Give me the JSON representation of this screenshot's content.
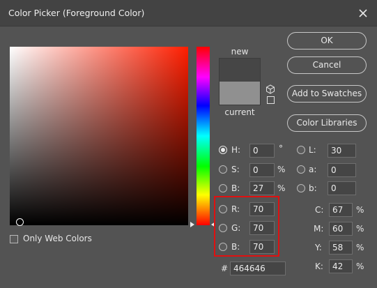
{
  "window": {
    "title": "Color Picker (Foreground Color)",
    "close_icon": "close-icon"
  },
  "preview": {
    "new_label": "new",
    "current_label": "current",
    "new_color": "#464646",
    "current_color": "#909090"
  },
  "buttons": {
    "ok": "OK",
    "cancel": "Cancel",
    "add_to_swatches": "Add to Swatches",
    "color_libraries": "Color Libraries"
  },
  "hsb": {
    "h_label": "H:",
    "h_value": "0",
    "h_unit": "°",
    "s_label": "S:",
    "s_value": "0",
    "s_unit": "%",
    "b_label": "B:",
    "b_value": "27",
    "b_unit": "%"
  },
  "lab": {
    "l_label": "L:",
    "l_value": "30",
    "a_label": "a:",
    "a_value": "0",
    "b_label": "b:",
    "b_value": "0"
  },
  "rgb": {
    "r_label": "R:",
    "r_value": "70",
    "g_label": "G:",
    "g_value": "70",
    "b_label": "B:",
    "b_value": "70"
  },
  "cmyk": {
    "c_label": "C:",
    "c_value": "67",
    "c_unit": "%",
    "m_label": "M:",
    "m_value": "60",
    "m_unit": "%",
    "y_label": "Y:",
    "y_value": "58",
    "y_unit": "%",
    "k_label": "K:",
    "k_value": "42",
    "k_unit": "%"
  },
  "hex": {
    "label": "#",
    "value": "464646"
  },
  "only_web_colors": {
    "label": "Only Web Colors",
    "checked": false
  },
  "selected_mode": "H",
  "colors": {
    "highlight": "#e01010",
    "dialog_bg": "#535353",
    "field_hue": "#ff1e00"
  }
}
